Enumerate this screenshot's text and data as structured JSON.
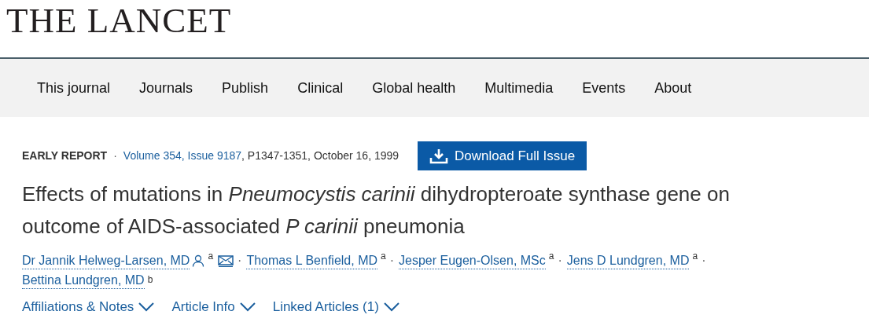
{
  "logo": "THE LANCET",
  "nav": [
    {
      "label": "This journal"
    },
    {
      "label": "Journals"
    },
    {
      "label": "Publish"
    },
    {
      "label": "Clinical"
    },
    {
      "label": "Global health"
    },
    {
      "label": "Multimedia"
    },
    {
      "label": "Events"
    },
    {
      "label": "About"
    }
  ],
  "meta": {
    "article_type": "EARLY REPORT",
    "separator": "·",
    "issue_link": "Volume 354, Issue 9187",
    "details": ", P1347-1351, October 16, 1999"
  },
  "download_button": "Download Full Issue",
  "title": "Effects of mutations in *Pneumocystis carinii* dihydropteroate synthase gene on outcome of AIDS-associated *P carinii* pneumonia",
  "authors": [
    {
      "name": "Dr Jannik Helweg-Larsen, MD",
      "affiliation": "a",
      "corresponding": true,
      "separator": "·"
    },
    {
      "name": "Thomas L Benfield, MD",
      "affiliation": "a",
      "corresponding": false,
      "separator": "·"
    },
    {
      "name": "Jesper Eugen-Olsen, MSc",
      "affiliation": "a",
      "corresponding": false,
      "separator": "·"
    },
    {
      "name": "Jens D Lundgren, MD",
      "affiliation": "a",
      "corresponding": false,
      "separator": "·"
    },
    {
      "name": "Bettina Lundgren, MD",
      "affiliation": "b",
      "corresponding": false
    }
  ],
  "toggles": [
    {
      "label": "Affiliations & Notes",
      "expanded": false
    },
    {
      "label": "Article Info",
      "expanded": false
    },
    {
      "label": "Linked Articles (1)",
      "expanded": false
    }
  ]
}
